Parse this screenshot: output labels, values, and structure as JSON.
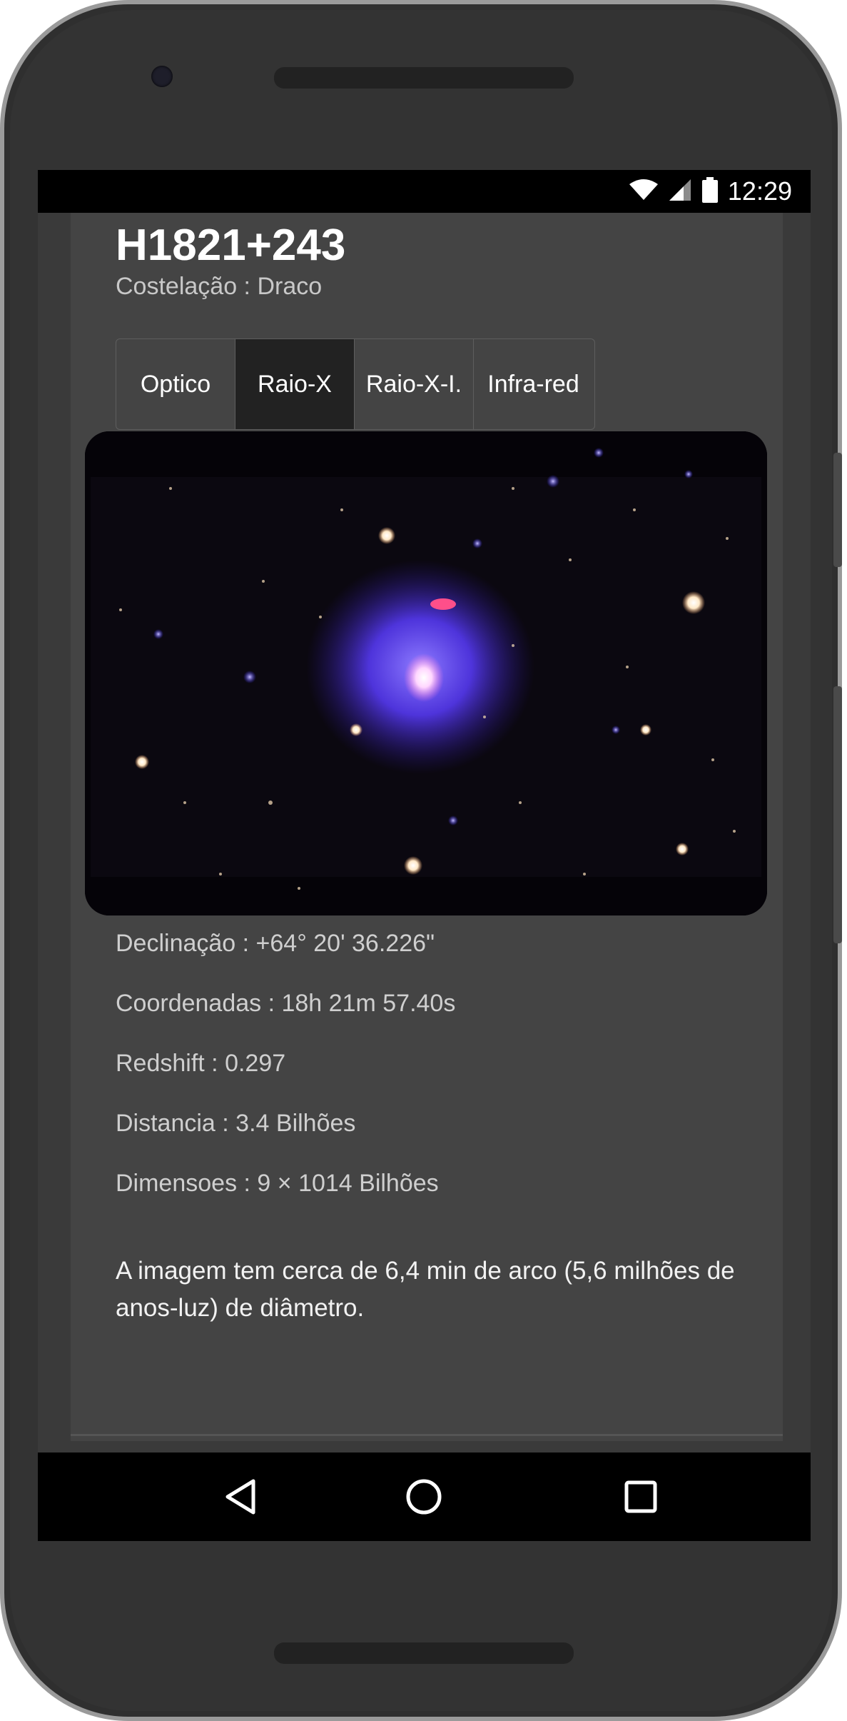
{
  "status_bar": {
    "time": "12:29",
    "icons": [
      "wifi-icon",
      "signal-icon",
      "battery-icon"
    ]
  },
  "object": {
    "name": "H1821+243",
    "constellation": "Costelação : Draco"
  },
  "tabs": [
    {
      "label": "Optico",
      "active": false
    },
    {
      "label": "Raio-X",
      "active": true
    },
    {
      "label": "Raio-X-I.",
      "active": false
    },
    {
      "label": "Infra-red",
      "active": false
    }
  ],
  "image": {
    "subject": "galaxy-cluster-xray-composite",
    "colors": {
      "halo": "#5a3cff",
      "core": "#ffffff",
      "jet": "#ff4f8a"
    }
  },
  "details": {
    "declination": "Declinação : +64° 20' 36.226\"",
    "coordinates": "Coordenadas : 18h 21m 57.40s",
    "redshift": "Redshift : 0.297",
    "distance": "Distancia : 3.4 Bilhões",
    "dimensions": "Dimensoes : 9 × 1014 Bilhões"
  },
  "description": "A imagem tem cerca de 6,4 min de arco (5,6 milhões de anos-luz) de diâmetro.",
  "nav_bar": {
    "buttons": [
      "back-icon",
      "home-icon",
      "recents-icon"
    ]
  },
  "colors": {
    "content_bg": "#444444",
    "active_tab_bg": "#222222",
    "status_bar_bg": "#000000"
  }
}
